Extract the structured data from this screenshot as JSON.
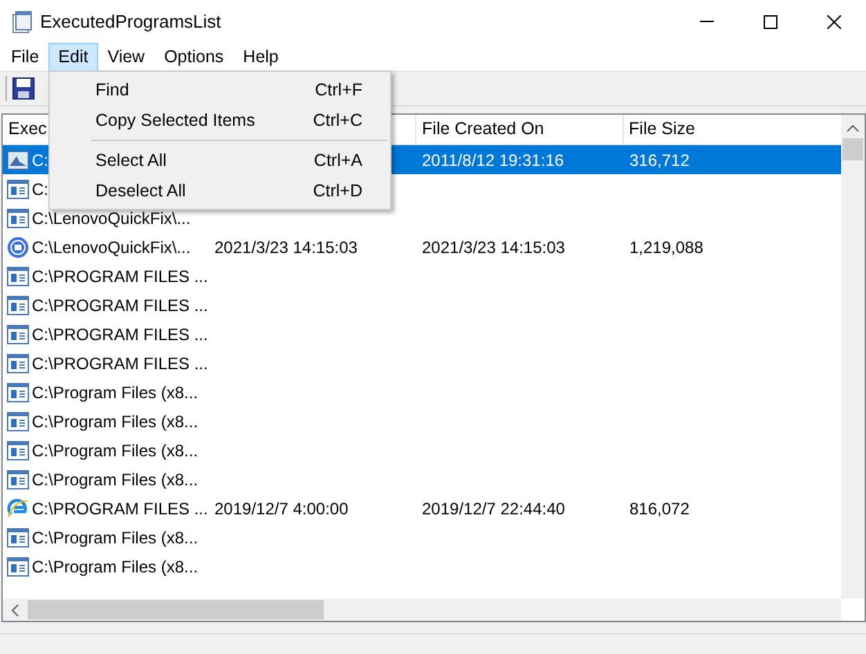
{
  "window": {
    "title": "ExecutedProgramsList"
  },
  "menu_bar": [
    {
      "label": "File",
      "selected": false
    },
    {
      "label": "Edit",
      "selected": true
    },
    {
      "label": "View",
      "selected": false
    },
    {
      "label": "Options",
      "selected": false
    },
    {
      "label": "Help",
      "selected": false
    }
  ],
  "edit_menu": [
    {
      "kind": "item",
      "label": "Find",
      "shortcut": "Ctrl+F"
    },
    {
      "kind": "item",
      "label": "Copy Selected Items",
      "shortcut": "Ctrl+C"
    },
    {
      "kind": "separator"
    },
    {
      "kind": "item",
      "label": "Select All",
      "shortcut": "Ctrl+A"
    },
    {
      "kind": "item",
      "label": "Deselect All",
      "shortcut": "Ctrl+D"
    }
  ],
  "table": {
    "columns": [
      {
        "label": "Exec"
      },
      {},
      {
        "label": "File Created On"
      },
      {
        "label": "File Size"
      }
    ],
    "rows": [
      {
        "kind": "app",
        "selected": true,
        "cells": [
          "C:",
          "",
          "2011/8/12 19:31:16",
          "316,712"
        ]
      },
      {
        "kind": "window",
        "selected": false,
        "cells": [
          "C:",
          "",
          "",
          ""
        ]
      },
      {
        "kind": "window",
        "selected": false,
        "cells": [
          "C:\\LenovoQuickFix\\...",
          "",
          "",
          ""
        ]
      },
      {
        "kind": "round",
        "selected": false,
        "cells": [
          "C:\\LenovoQuickFix\\...",
          "2021/3/23 14:15:03",
          "2021/3/23 14:15:03",
          "1,219,088"
        ]
      },
      {
        "kind": "window",
        "selected": false,
        "cells": [
          "C:\\PROGRAM FILES ...",
          "",
          "",
          ""
        ]
      },
      {
        "kind": "window",
        "selected": false,
        "cells": [
          "C:\\PROGRAM FILES ...",
          "",
          "",
          ""
        ]
      },
      {
        "kind": "window",
        "selected": false,
        "cells": [
          "C:\\PROGRAM FILES ...",
          "",
          "",
          ""
        ]
      },
      {
        "kind": "window",
        "selected": false,
        "cells": [
          "C:\\PROGRAM FILES ...",
          "",
          "",
          ""
        ]
      },
      {
        "kind": "window",
        "selected": false,
        "cells": [
          "C:\\Program Files (x8...",
          "",
          "",
          ""
        ]
      },
      {
        "kind": "window",
        "selected": false,
        "cells": [
          "C:\\Program Files (x8...",
          "",
          "",
          ""
        ]
      },
      {
        "kind": "window",
        "selected": false,
        "cells": [
          "C:\\Program Files (x8...",
          "",
          "",
          ""
        ]
      },
      {
        "kind": "window",
        "selected": false,
        "cells": [
          "C:\\Program Files (x8...",
          "",
          "",
          ""
        ]
      },
      {
        "kind": "browser",
        "selected": false,
        "cells": [
          "C:\\PROGRAM FILES ...",
          "2019/12/7 4:00:00",
          "2019/12/7 22:44:40",
          "816,072"
        ]
      },
      {
        "kind": "window",
        "selected": false,
        "cells": [
          "C:\\Program Files (x8...",
          "",
          "",
          ""
        ]
      },
      {
        "kind": "window",
        "selected": false,
        "cells": [
          "C:\\Program Files (x8...",
          "",
          "",
          ""
        ]
      }
    ]
  }
}
